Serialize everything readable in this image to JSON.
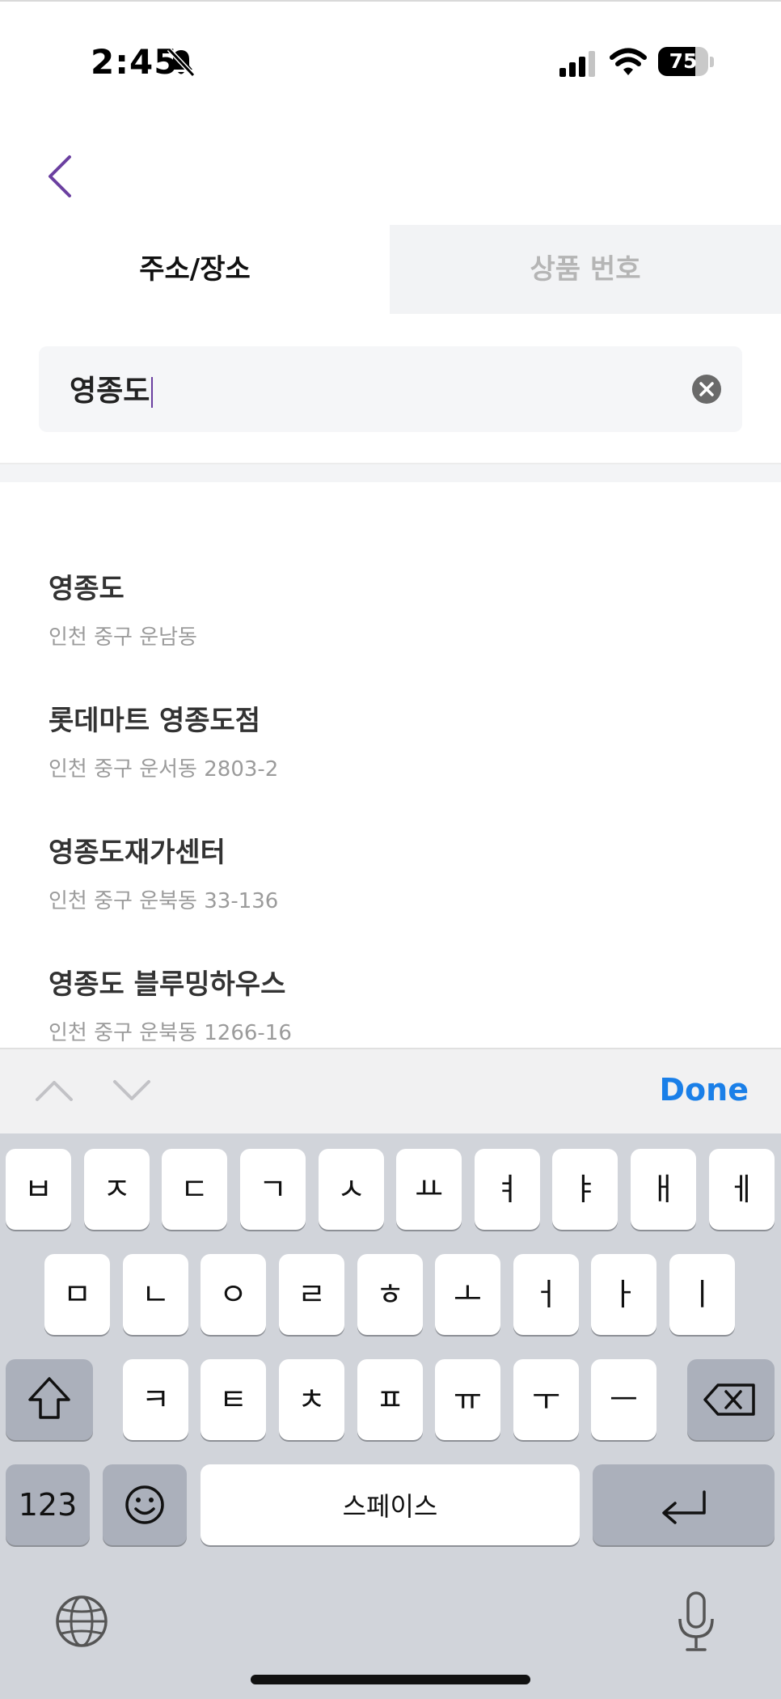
{
  "status_bar": {
    "time": "2:45",
    "battery": "75",
    "icons": [
      "bell-slash-icon",
      "signal-icon",
      "wifi-icon",
      "battery-icon"
    ]
  },
  "nav": {
    "back_icon": "chevron-left-icon"
  },
  "tabs": [
    {
      "label": "주소/장소",
      "active": true
    },
    {
      "label": "상품 번호",
      "active": false
    }
  ],
  "search": {
    "value": "영종도",
    "clear_icon": "clear-circle-icon"
  },
  "results": [
    {
      "title": "영종도",
      "address": "인천 중구 운남동"
    },
    {
      "title": "롯데마트 영종도점",
      "address": "인천 중구 운서동 2803-2"
    },
    {
      "title": "영종도재가센터",
      "address": "인천 중구 운북동 33-136"
    },
    {
      "title": "영종도 블루밍하우스",
      "address": "인천 중구 운북동 1266-16"
    }
  ],
  "accessory": {
    "done_label": "Done",
    "icons": [
      "chevron-up-icon",
      "chevron-down-icon"
    ]
  },
  "keyboard": {
    "row1": [
      "ㅂ",
      "ㅈ",
      "ㄷ",
      "ㄱ",
      "ㅅ",
      "ㅛ",
      "ㅕ",
      "ㅑ",
      "ㅐ",
      "ㅔ"
    ],
    "row2": [
      "ㅁ",
      "ㄴ",
      "ㅇ",
      "ㄹ",
      "ㅎ",
      "ㅗ",
      "ㅓ",
      "ㅏ",
      "ㅣ"
    ],
    "row3": [
      "ㅋ",
      "ㅌ",
      "ㅊ",
      "ㅍ",
      "ㅠ",
      "ㅜ",
      "ㅡ"
    ],
    "numbers_label": "123",
    "space_label": "스페이스",
    "icons": [
      "shift-icon",
      "backspace-icon",
      "emoji-icon",
      "return-icon",
      "globe-icon",
      "microphone-icon"
    ]
  },
  "colors": {
    "accent": "#6b3fa0",
    "done": "#1a7fe8",
    "keyboard_bg": "#d1d4da"
  }
}
